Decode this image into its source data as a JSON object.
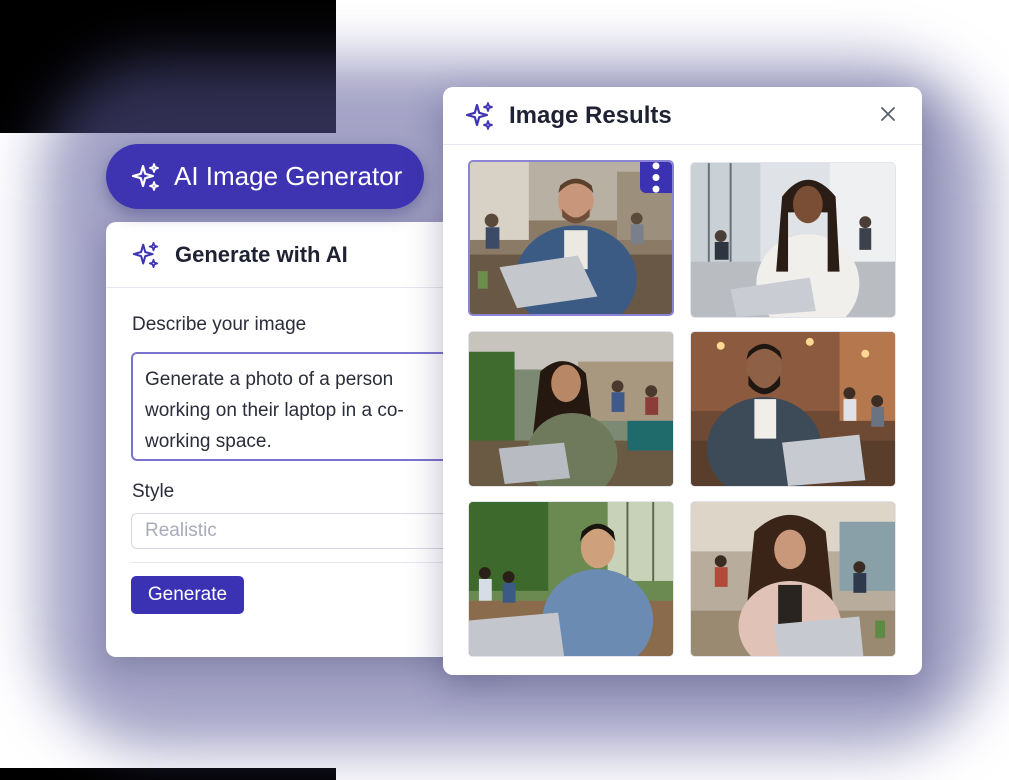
{
  "pill": {
    "label": "AI Image Generator",
    "icon": "sparkles-icon"
  },
  "generator": {
    "title": "Generate with AI",
    "icon": "sparkles-icon",
    "describe_label": "Describe your image",
    "prompt_lines": [
      "Generate a photo of a person",
      "working on their laptop in a co-",
      "working space."
    ],
    "style_label": "Style",
    "style_placeholder": "Realistic",
    "generate_label": "Generate"
  },
  "results": {
    "title": "Image Results",
    "icon": "sparkles-icon",
    "close_icon": "close-icon",
    "more_icon": "more-vertical-icon",
    "images": [
      {
        "subject": "man-denim-shirt-laptop",
        "selected": true
      },
      {
        "subject": "woman-braids-white-blouse",
        "selected": false
      },
      {
        "subject": "woman-green-top-laptop",
        "selected": false
      },
      {
        "subject": "bearded-man-laptop-brick-cafe",
        "selected": false
      },
      {
        "subject": "man-blue-henley-green-wall",
        "selected": false
      },
      {
        "subject": "woman-curly-hair-pink-cardigan",
        "selected": false
      }
    ]
  },
  "colors": {
    "brand": "#3e34b2",
    "accent_border": "#7b72cf",
    "spark": "#3e34b2"
  }
}
